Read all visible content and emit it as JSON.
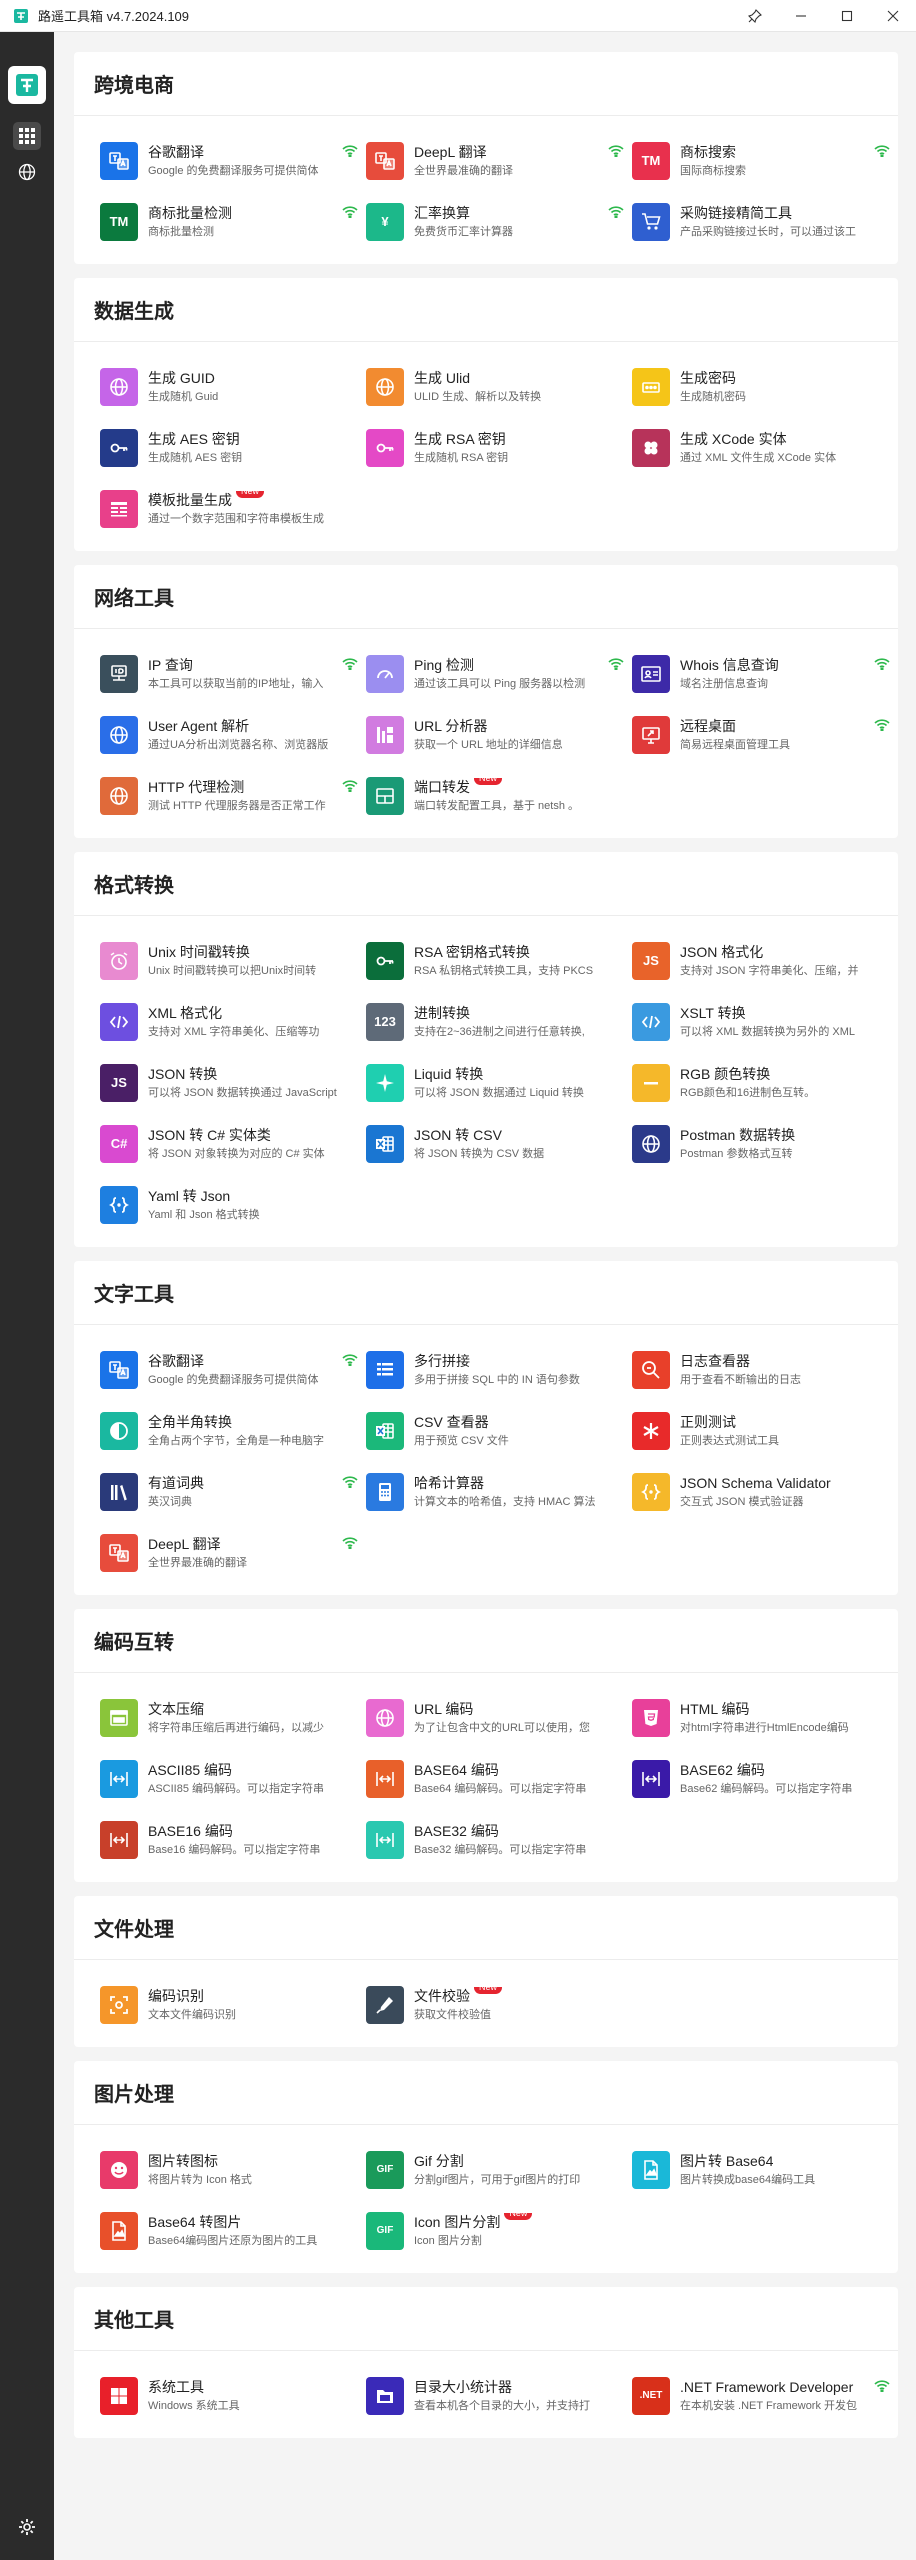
{
  "window": {
    "title": "路遥工具箱 v4.7.2024.109",
    "controls": [
      "pin-icon",
      "minimize-icon",
      "maximize-icon",
      "close-icon"
    ]
  },
  "colors": {
    "sidebar_bg": "#2b2b2b",
    "wifi_green": "#2db84c",
    "new_badge": "#e5242f"
  },
  "sections": [
    {
      "title": "跨境电商",
      "tiles": [
        {
          "name": "谷歌翻译",
          "desc": "Google 的免费翻译服务可提供简体",
          "icon": "translate-icon",
          "color": "#1a73e8",
          "wifi": true,
          "new": false
        },
        {
          "name": "DeepL 翻译",
          "desc": "全世界最准确的翻译",
          "icon": "translate-icon",
          "color": "#e74c3c",
          "wifi": true,
          "new": false
        },
        {
          "name": "商标搜索",
          "desc": "国际商标搜索",
          "icon": "trademark-icon",
          "color": "#e8304d",
          "wifi": true,
          "new": false
        },
        {
          "name": "商标批量检测",
          "desc": "商标批量检测",
          "icon": "trademark-icon",
          "color": "#0b7a3e",
          "wifi": true,
          "new": false
        },
        {
          "name": "汇率换算",
          "desc": "免费货币汇率计算器",
          "icon": "yen-icon",
          "color": "#1cb88a",
          "wifi": true,
          "new": false
        },
        {
          "name": "采购链接精简工具",
          "desc": "产品采购链接过长时，可以通过该工",
          "icon": "cart-icon",
          "color": "#2f5fd0",
          "wifi": false,
          "new": false
        }
      ]
    },
    {
      "title": "数据生成",
      "tiles": [
        {
          "name": "生成 GUID",
          "desc": "生成随机 Guid",
          "icon": "globe-icon",
          "color": "#c565e8",
          "wifi": false,
          "new": false
        },
        {
          "name": "生成 Ulid",
          "desc": "ULID 生成、解析以及转换",
          "icon": "globe-icon",
          "color": "#f28b30",
          "wifi": false,
          "new": false
        },
        {
          "name": "生成密码",
          "desc": "生成随机密码",
          "icon": "password-icon",
          "color": "#f5c518",
          "wifi": false,
          "new": false
        },
        {
          "name": "生成 AES 密钥",
          "desc": "生成随机 AES 密钥",
          "icon": "key-icon",
          "color": "#243b8a",
          "wifi": false,
          "new": false
        },
        {
          "name": "生成 RSA 密钥",
          "desc": "生成随机 RSA 密钥",
          "icon": "key-icon",
          "color": "#e449c6",
          "wifi": false,
          "new": false
        },
        {
          "name": "生成 XCode 实体",
          "desc": "通过 XML 文件生成 XCode 实体",
          "icon": "clover-icon",
          "color": "#b7335a",
          "wifi": false,
          "new": false
        },
        {
          "name": "模板批量生成",
          "desc": "通过一个数字范围和字符串模板生成",
          "icon": "template-icon",
          "color": "#e8408a",
          "wifi": false,
          "new": true
        }
      ]
    },
    {
      "title": "网络工具",
      "tiles": [
        {
          "name": "IP 查询",
          "desc": "本工具可以获取当前的IP地址，输入",
          "icon": "ip-icon",
          "color": "#3a4f5c",
          "wifi": true,
          "new": false
        },
        {
          "name": "Ping 检测",
          "desc": "通过该工具可以 Ping 服务器以检测",
          "icon": "gauge-icon",
          "color": "#9b8ef0",
          "wifi": true,
          "new": false
        },
        {
          "name": "Whois 信息查询",
          "desc": "域名注册信息查询",
          "icon": "id-card-icon",
          "color": "#3d2aa8",
          "wifi": true,
          "new": false
        },
        {
          "name": "User Agent 解析",
          "desc": "通过UA分析出浏览器名称、浏览器版",
          "icon": "globe-icon",
          "color": "#2a6ee8",
          "wifi": false,
          "new": false
        },
        {
          "name": "URL 分析器",
          "desc": "获取一个 URL 地址的详细信息",
          "icon": "url-icon",
          "color": "#d17be0",
          "wifi": false,
          "new": false
        },
        {
          "name": "远程桌面",
          "desc": "简易远程桌面管理工具",
          "icon": "remote-desktop-icon",
          "color": "#e03a3a",
          "wifi": true,
          "new": false
        },
        {
          "name": "HTTP 代理检测",
          "desc": "测试 HTTP 代理服务器是否正常工作",
          "icon": "globe-icon",
          "color": "#e06a3a",
          "wifi": true,
          "new": false
        },
        {
          "name": "端口转发",
          "desc": "端口转发配置工具，基于 netsh 。",
          "icon": "port-icon",
          "color": "#1a9a76",
          "wifi": false,
          "new": true
        }
      ]
    },
    {
      "title": "格式转换",
      "tiles": [
        {
          "name": "Unix 时间戳转换",
          "desc": "Unix 时间戳转换可以把Unix时间转",
          "icon": "alarm-icon",
          "color": "#e88ad0",
          "wifi": false,
          "new": false
        },
        {
          "name": "RSA 密钥格式转换",
          "desc": "RSA 私钥格式转换工具，支持 PKCS",
          "icon": "key-icon",
          "color": "#0b6e3b",
          "wifi": false,
          "new": false
        },
        {
          "name": "JSON 格式化",
          "desc": "支持对 JSON 字符串美化、压缩，并",
          "icon": "js-icon",
          "color": "#e8632a",
          "wifi": false,
          "new": false
        },
        {
          "name": "XML 格式化",
          "desc": "支持对 XML 字符串美化、压缩等功",
          "icon": "code-icon",
          "color": "#6d4fe0",
          "wifi": false,
          "new": false
        },
        {
          "name": "进制转换",
          "desc": "支持在2~36进制之间进行任意转换,",
          "icon": "number-icon",
          "color": "#5e6a78",
          "wifi": false,
          "new": false
        },
        {
          "name": "XSLT 转换",
          "desc": "可以将 XML 数据转换为另外的 XML",
          "icon": "code-icon",
          "color": "#3a9ae0",
          "wifi": false,
          "new": false
        },
        {
          "name": "JSON 转换",
          "desc": "可以将 JSON 数据转换通过 JavaScript",
          "icon": "js-icon",
          "color": "#4a1f66",
          "wifi": false,
          "new": false
        },
        {
          "name": "Liquid 转换",
          "desc": "可以将 JSON 数据通过 Liquid 转换",
          "icon": "sparkle-icon",
          "color": "#1fcfb0",
          "wifi": false,
          "new": false
        },
        {
          "name": "RGB 颜色转换",
          "desc": "RGB颜色和16进制色互转。",
          "icon": "minus-icon",
          "color": "#f5b82a",
          "wifi": false,
          "new": false
        },
        {
          "name": "JSON 转 C# 实体类",
          "desc": "将 JSON 对象转换为对应的 C# 实体",
          "icon": "csharp-icon",
          "color": "#d94ad0",
          "wifi": false,
          "new": false
        },
        {
          "name": "JSON 转 CSV",
          "desc": "将 JSON 转换为 CSV 数据",
          "icon": "excel-icon",
          "color": "#1a76d2",
          "wifi": false,
          "new": false
        },
        {
          "name": "Postman 数据转换",
          "desc": "Postman 参数格式互转",
          "icon": "globe-icon",
          "color": "#2b3a8a",
          "wifi": false,
          "new": false
        },
        {
          "name": "Yaml 转 Json",
          "desc": "Yaml 和 Json 格式转换",
          "icon": "braces-icon",
          "color": "#1e7fe0",
          "wifi": false,
          "new": false
        }
      ]
    },
    {
      "title": "文字工具",
      "tiles": [
        {
          "name": "谷歌翻译",
          "desc": "Google 的免费翻译服务可提供简体",
          "icon": "translate-icon",
          "color": "#1a73e8",
          "wifi": true,
          "new": false
        },
        {
          "name": "多行拼接",
          "desc": "多用于拼接 SQL 中的 IN 语句参数",
          "icon": "list-icon",
          "color": "#1e6fe8",
          "wifi": false,
          "new": false
        },
        {
          "name": "日志查看器",
          "desc": "用于查看不断输出的日志",
          "icon": "search-icon",
          "color": "#e8402a",
          "wifi": false,
          "new": false
        },
        {
          "name": "全角半角转换",
          "desc": "全角占两个字节，全角是一种电脑字",
          "icon": "halfcircle-icon",
          "color": "#1ab8a0",
          "wifi": false,
          "new": false
        },
        {
          "name": "CSV 查看器",
          "desc": "用于预览 CSV 文件",
          "icon": "excel-icon",
          "color": "#1bb87a",
          "wifi": false,
          "new": false
        },
        {
          "name": "正则测试",
          "desc": "正则表达式测试工具",
          "icon": "asterisk-icon",
          "color": "#e82a2a",
          "wifi": false,
          "new": false
        },
        {
          "name": "有道词典",
          "desc": "英汉词典",
          "icon": "books-icon",
          "color": "#2a3a7a",
          "wifi": true,
          "new": false
        },
        {
          "name": "哈希计算器",
          "desc": "计算文本的哈希值，支持 HMAC 算法",
          "icon": "calculator-icon",
          "color": "#2a7ae0",
          "wifi": false,
          "new": false
        },
        {
          "name": "JSON Schema Validator",
          "desc": "交互式 JSON 模式验证器",
          "icon": "braces-icon",
          "color": "#f5b82a",
          "wifi": false,
          "new": false
        },
        {
          "name": "DeepL 翻译",
          "desc": "全世界最准确的翻译",
          "icon": "translate-icon",
          "color": "#e74c3c",
          "wifi": true,
          "new": false
        }
      ]
    },
    {
      "title": "编码互转",
      "tiles": [
        {
          "name": "文本压缩",
          "desc": "将字符串压缩后再进行编码，以减少",
          "icon": "window-icon",
          "color": "#8ac53a",
          "wifi": false,
          "new": false
        },
        {
          "name": "URL 编码",
          "desc": "为了让包含中文的URL可以使用，您",
          "icon": "globe-icon",
          "color": "#e86ad0",
          "wifi": false,
          "new": false
        },
        {
          "name": "HTML 编码",
          "desc": "对html字符串进行HtmlEncode编码",
          "icon": "html5-icon",
          "color": "#e8409a",
          "wifi": false,
          "new": false
        },
        {
          "name": "ASCII85 编码",
          "desc": "ASCII85 编码解码。可以指定字符串",
          "icon": "encode-icon",
          "color": "#1a9ae0",
          "wifi": false,
          "new": false
        },
        {
          "name": "BASE64 编码",
          "desc": "Base64 编码解码。可以指定字符串",
          "icon": "encode-icon",
          "color": "#e8602a",
          "wifi": false,
          "new": false
        },
        {
          "name": "BASE62 编码",
          "desc": "Base62 编码解码。可以指定字符串",
          "icon": "encode-icon",
          "color": "#3a1aa8",
          "wifi": false,
          "new": false
        },
        {
          "name": "BASE16 编码",
          "desc": "Base16 编码解码。可以指定字符串",
          "icon": "encode-icon",
          "color": "#c8402a",
          "wifi": false,
          "new": false
        },
        {
          "name": "BASE32 编码",
          "desc": "Base32 编码解码。可以指定字符串",
          "icon": "encode-icon",
          "color": "#2ac8b0",
          "wifi": false,
          "new": false
        }
      ]
    },
    {
      "title": "文件处理",
      "tiles": [
        {
          "name": "编码识别",
          "desc": "文本文件编码识别",
          "icon": "scan-icon",
          "color": "#f5962a",
          "wifi": false,
          "new": false
        },
        {
          "name": "文件校验",
          "desc": "获取文件校验值",
          "icon": "pen-icon",
          "color": "#3a4a5a",
          "wifi": false,
          "new": true
        }
      ]
    },
    {
      "title": "图片处理",
      "tiles": [
        {
          "name": "图片转图标",
          "desc": "将图片转为 Icon 格式",
          "icon": "smile-icon",
          "color": "#e83a6a",
          "wifi": false,
          "new": false
        },
        {
          "name": "Gif 分割",
          "desc": "分割gif图片，可用于gif图片的打印",
          "icon": "gif-icon",
          "color": "#1a9a5a",
          "wifi": false,
          "new": false
        },
        {
          "name": "图片转 Base64",
          "desc": "图片转换成base64编码工具",
          "icon": "image-file-icon",
          "color": "#1ab8d8",
          "wifi": false,
          "new": false
        },
        {
          "name": "Base64 转图片",
          "desc": "Base64编码图片还原为图片的工具",
          "icon": "image-file-icon",
          "color": "#e8502a",
          "wifi": false,
          "new": false
        },
        {
          "name": "Icon 图片分割",
          "desc": "Icon 图片分割",
          "icon": "gif-icon",
          "color": "#1ab87a",
          "wifi": false,
          "new": true
        }
      ]
    },
    {
      "title": "其他工具",
      "tiles": [
        {
          "name": "系统工具",
          "desc": "Windows 系统工具",
          "icon": "windows-icon",
          "color": "#e8202a",
          "wifi": false,
          "new": false
        },
        {
          "name": "目录大小统计器",
          "desc": "查看本机各个目录的大小，并支持打",
          "icon": "folder-icon",
          "color": "#3a2ab8",
          "wifi": false,
          "new": false
        },
        {
          "name": ".NET Framework Developer",
          "desc": "在本机安装 .NET Framework 开发包",
          "icon": "net-icon",
          "color": "#d8301a",
          "wifi": true,
          "new": false
        }
      ]
    }
  ],
  "new_label": "New",
  "icon_text": {
    "trademark-icon": "TM",
    "yen-icon": "¥",
    "js-icon": "JS",
    "number-icon": "123",
    "gif-icon": "GIF",
    "net-icon": ".NET",
    "csharp-icon": "C#"
  }
}
